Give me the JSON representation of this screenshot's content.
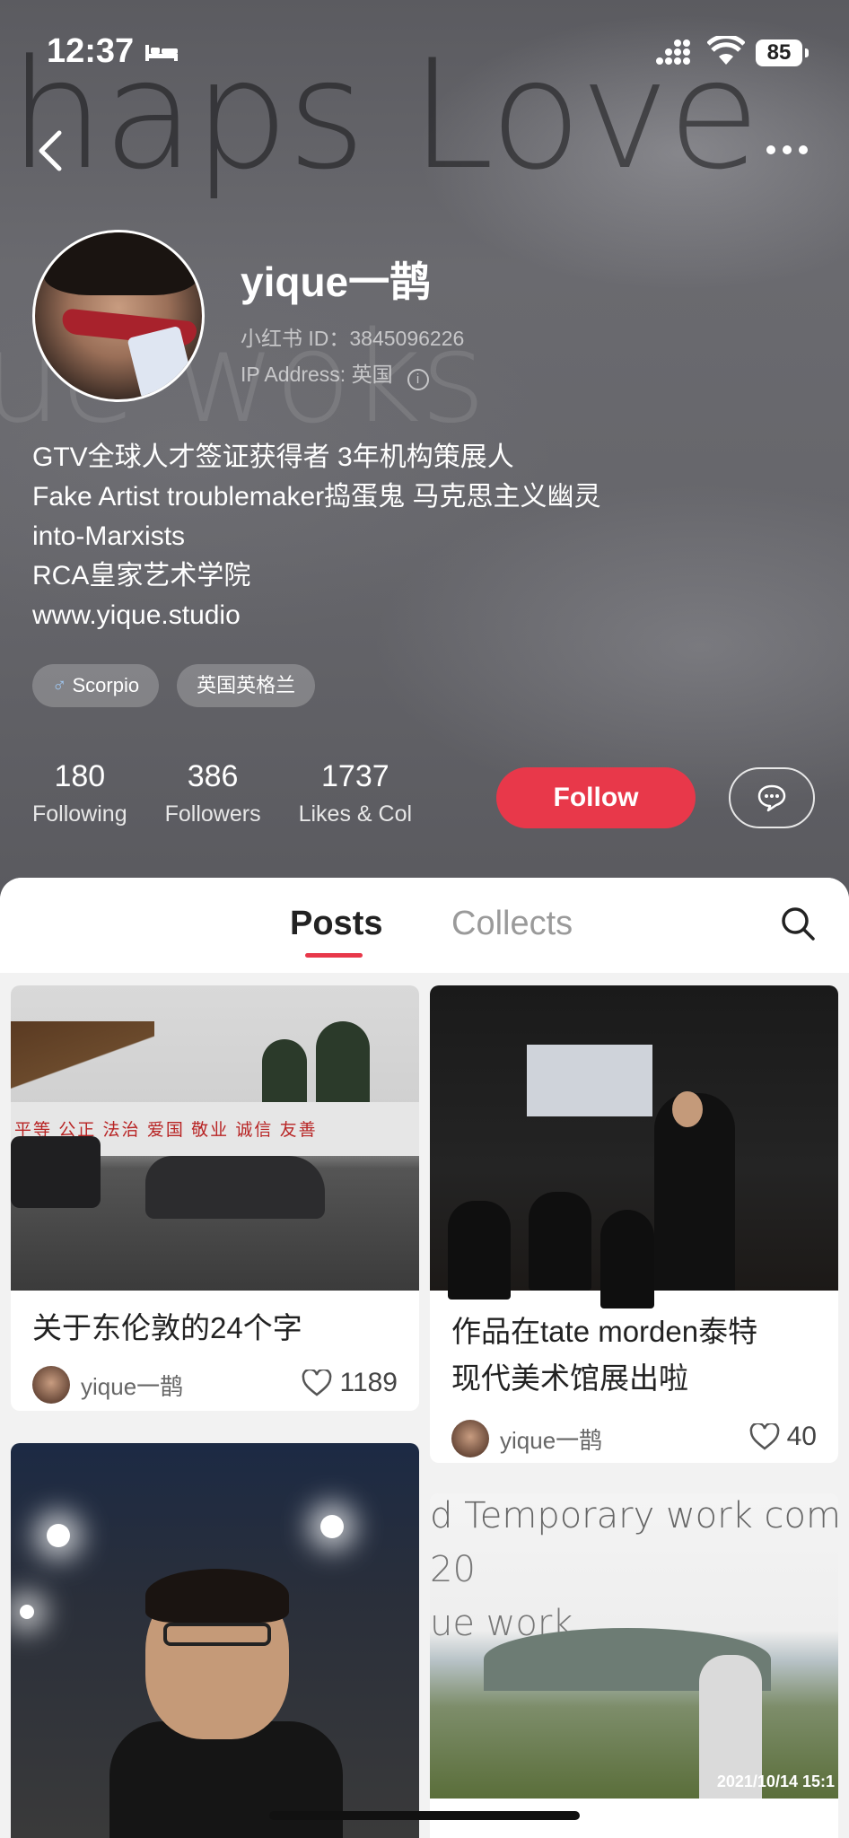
{
  "status_bar": {
    "time": "12:37",
    "battery": "85"
  },
  "header": {
    "background_text": [
      "haps Love",
      "ue woks"
    ]
  },
  "profile": {
    "username": "yique一鹊",
    "red_id": "小红书 ID：3845096226",
    "ip_address": "IP Address: 英国",
    "bio_lines": [
      "GTV全球人才签证获得者  3年机构策展人",
      "Fake Artist troublemaker捣蛋鬼 马克思主义幽灵",
      "into-Marxists",
      "RCA皇家艺术学院",
      "www.yique.studio"
    ],
    "tags": [
      {
        "icon": "male-symbol-icon",
        "label": "Scorpio"
      },
      {
        "label": "英国英格兰"
      }
    ],
    "stats": [
      {
        "value": "180",
        "label": "Following"
      },
      {
        "value": "386",
        "label": "Followers"
      },
      {
        "value": "1737",
        "label": "Likes & Col"
      }
    ],
    "follow_label": "Follow"
  },
  "tabs": [
    {
      "label": "Posts",
      "active": true
    },
    {
      "label": "Collects",
      "active": false
    }
  ],
  "posts": [
    {
      "title_lines": [
        "关于东伦敦的24个字"
      ],
      "author": "yique一鹊",
      "likes": "1189",
      "image_text": "平等  公正  法治  爱国  敬业  诚信  友善"
    },
    {
      "title_lines": [
        "作品在tate morden泰特",
        "现代美术馆展出啦"
      ],
      "author": "yique一鹊",
      "likes": "40"
    },
    {
      "title_lines": [],
      "author": "",
      "likes": ""
    },
    {
      "title_lines": [],
      "author": "",
      "likes": "",
      "image_text": [
        "d Temporary work comp",
        "20",
        "ue work"
      ],
      "image_date": "2021/10/14  15:1"
    }
  ],
  "colors": {
    "accent": "#e8384a"
  }
}
